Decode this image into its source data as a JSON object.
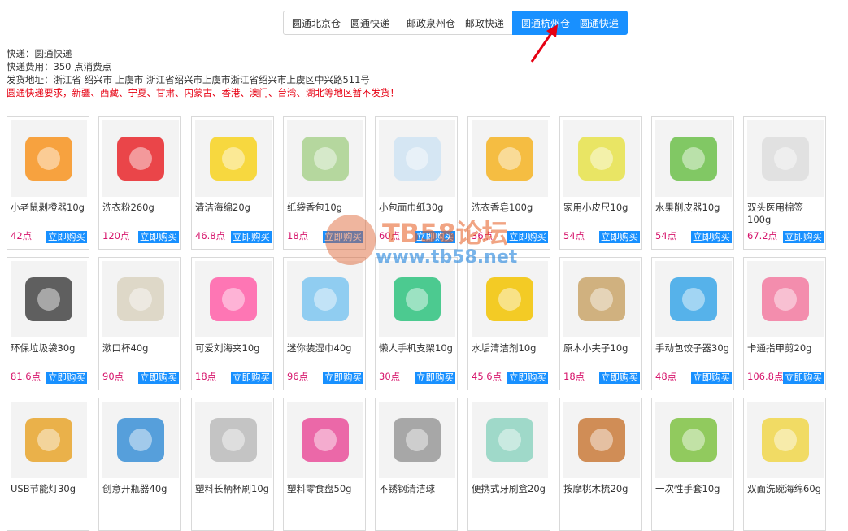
{
  "tabs": [
    {
      "label": "圆通北京仓 - 圆通快递",
      "active": false
    },
    {
      "label": "邮政泉州仓 - 邮政快递",
      "active": false
    },
    {
      "label": "圆通杭州仓 - 圆通快递",
      "active": true
    }
  ],
  "info": {
    "express": "快递：圆通快递",
    "fee": "快递费用：350 点消费点",
    "address": "发货地址：浙江省 绍兴市 上虞市 浙江省绍兴市上虞市浙江省绍兴市上虞区中兴路511号",
    "warning": "圆通快递要求，新疆、西藏、宁夏、甘肃、内蒙古、香港、澳门、台湾、湖北等地区暂不发货！"
  },
  "buy_label": "立即购买",
  "watermark": {
    "line1": "TB58论坛",
    "line2": "www.tb58.net"
  },
  "products": [
    {
      "name": "小老鼠剥橙器10g",
      "points": "42点",
      "icon": "orange-peeler-icon",
      "color": "#f7931e"
    },
    {
      "name": "洗衣粉260g",
      "points": "120点",
      "icon": "detergent-icon",
      "color": "#e8262a"
    },
    {
      "name": "清洁海绵20g",
      "points": "46.8点",
      "icon": "sponge-icon",
      "color": "#f7d21e"
    },
    {
      "name": "纸袋香包10g",
      "points": "18点",
      "icon": "sachet-icon",
      "color": "#a9d18e"
    },
    {
      "name": "小包面巾纸30g",
      "points": "60点",
      "icon": "tissue-icon",
      "color": "#cfe3f2"
    },
    {
      "name": "洗衣香皂100g",
      "points": "36点",
      "icon": "soap-icon",
      "color": "#f5b322"
    },
    {
      "name": "家用小皮尺10g",
      "points": "54点",
      "icon": "tape-measure-icon",
      "color": "#e6e24a"
    },
    {
      "name": "水果削皮器10g",
      "points": "54点",
      "icon": "peeler-icon",
      "color": "#6cc04a"
    },
    {
      "name": "双头医用棉签100g",
      "points": "67.2点",
      "icon": "cotton-swab-icon",
      "color": "#dddddd"
    },
    {
      "name": "环保垃圾袋30g",
      "points": "81.6点",
      "icon": "garbage-bag-icon",
      "color": "#444444"
    },
    {
      "name": "漱口杯40g",
      "points": "90点",
      "icon": "cup-icon",
      "color": "#d9d2c0"
    },
    {
      "name": "可爱刘海夹10g",
      "points": "18点",
      "icon": "hair-clip-icon",
      "color": "#ff5fa8"
    },
    {
      "name": "迷你装湿巾40g",
      "points": "96点",
      "icon": "wet-wipes-icon",
      "color": "#7ec6f0"
    },
    {
      "name": "懒人手机支架10g",
      "points": "30点",
      "icon": "phone-stand-icon",
      "color": "#2ec27e"
    },
    {
      "name": "水垢清洁剂10g",
      "points": "45.6点",
      "icon": "descaler-icon",
      "color": "#f2c300"
    },
    {
      "name": "原木小夹子10g",
      "points": "18点",
      "icon": "wood-clip-icon",
      "color": "#c9a56a"
    },
    {
      "name": "手动包饺子器30g",
      "points": "48点",
      "icon": "dumpling-maker-icon",
      "color": "#3aa6e8"
    },
    {
      "name": "卡通指甲剪20g",
      "points": "106.8点",
      "icon": "nail-clipper-icon",
      "color": "#f27aa0"
    },
    {
      "name": "USB节能灯30g",
      "points": "",
      "icon": "usb-lamp-icon",
      "color": "#e8a52c"
    },
    {
      "name": "创意开瓶器40g",
      "points": "",
      "icon": "bottle-opener-icon",
      "color": "#3a8fd6"
    },
    {
      "name": "塑料长柄杯刷10g",
      "points": "",
      "icon": "cup-brush-icon",
      "color": "#bbbbbb"
    },
    {
      "name": "塑料零食盘50g",
      "points": "",
      "icon": "snack-plate-icon",
      "color": "#e94f9a"
    },
    {
      "name": "不锈钢清洁球",
      "points": "",
      "icon": "steel-wool-icon",
      "color": "#999999"
    },
    {
      "name": "便携式牙刷盒20g",
      "points": "",
      "icon": "toothbrush-box-icon",
      "color": "#8fd4c1"
    },
    {
      "name": "按摩桃木梳20g",
      "points": "",
      "icon": "wood-comb-icon",
      "color": "#c97a3a"
    },
    {
      "name": "一次性手套10g",
      "points": "",
      "icon": "gloves-icon",
      "color": "#7fc243"
    },
    {
      "name": "双面洗碗海绵60g",
      "points": "",
      "icon": "dish-sponge-icon",
      "color": "#f0d64a"
    }
  ]
}
